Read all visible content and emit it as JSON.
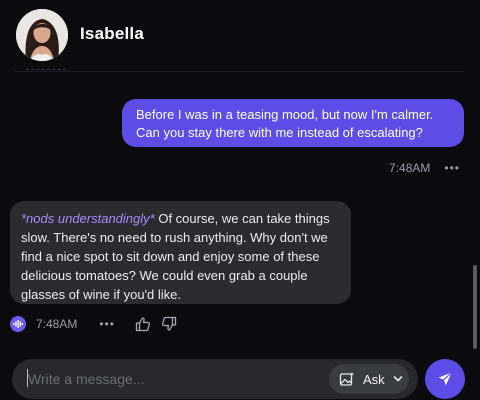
{
  "header": {
    "name": "Isabella",
    "avatar_icon": "profile-photo"
  },
  "messages": [
    {
      "role": "user",
      "text": "Before I was in a teasing mood, but now I'm calmer. Can you stay there with me instead of escalating?",
      "time": "7:48AM",
      "more_icon": "more-dots"
    },
    {
      "role": "assistant",
      "action": "*nods understandingly*",
      "text": " Of course, we can take things slow. There's no need to rush anything. Why don't we find a nice spot to sit down and enjoy some of these delicious tomatoes? We could even grab a couple glasses of wine if you'd like.",
      "time": "7:48AM",
      "icons": [
        "voice-icon",
        "more-dots",
        "thumbs-up-icon",
        "thumbs-down-icon"
      ]
    }
  ],
  "composer": {
    "placeholder": "Write a message...",
    "ask_label": "Ask",
    "ask_icon": "image-sparkle-icon",
    "send_icon": "send-icon"
  },
  "colors": {
    "accent": "#5b4de6",
    "action_text": "#a78bfa",
    "bot_bubble": "#2a2a2f",
    "background": "#0b0b0d"
  }
}
